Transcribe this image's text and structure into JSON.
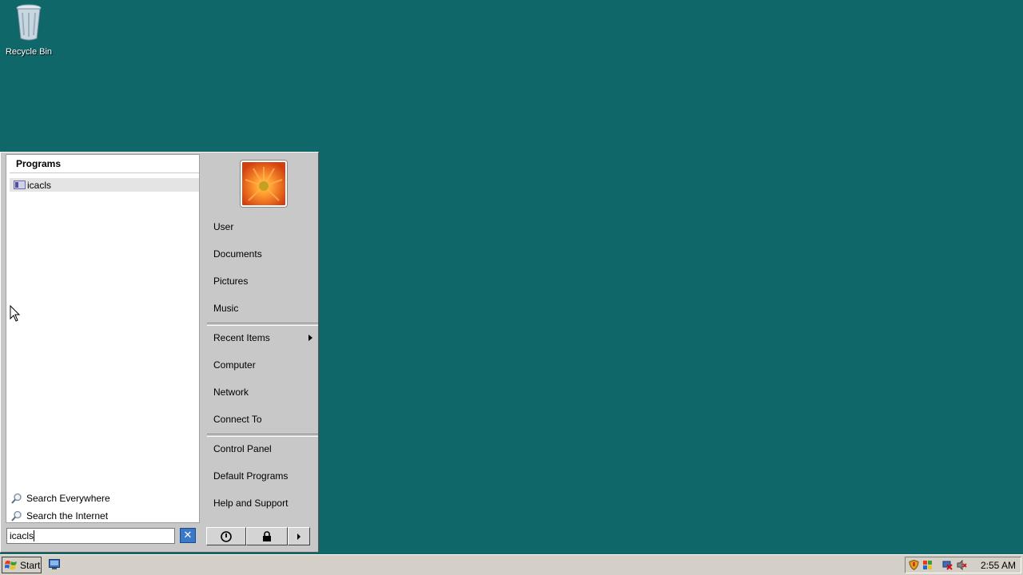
{
  "desktop": {
    "recycle_bin_label": "Recycle Bin",
    "background_color": "#10676a"
  },
  "start_menu": {
    "programs_header": "Programs",
    "programs": [
      {
        "label": "icacls",
        "icon": "console-app-icon"
      }
    ],
    "search_options": {
      "everywhere": "Search Everywhere",
      "internet": "Search the Internet"
    },
    "search_value": "icacls",
    "right_items": {
      "user": "User",
      "documents": "Documents",
      "pictures": "Pictures",
      "music": "Music",
      "recent_items": "Recent Items",
      "computer": "Computer",
      "network": "Network",
      "connect_to": "Connect To",
      "control_panel": "Control Panel",
      "default_programs": "Default Programs",
      "help_support": "Help and Support"
    }
  },
  "taskbar": {
    "start_label": "Start",
    "clock": "2:55 AM"
  }
}
